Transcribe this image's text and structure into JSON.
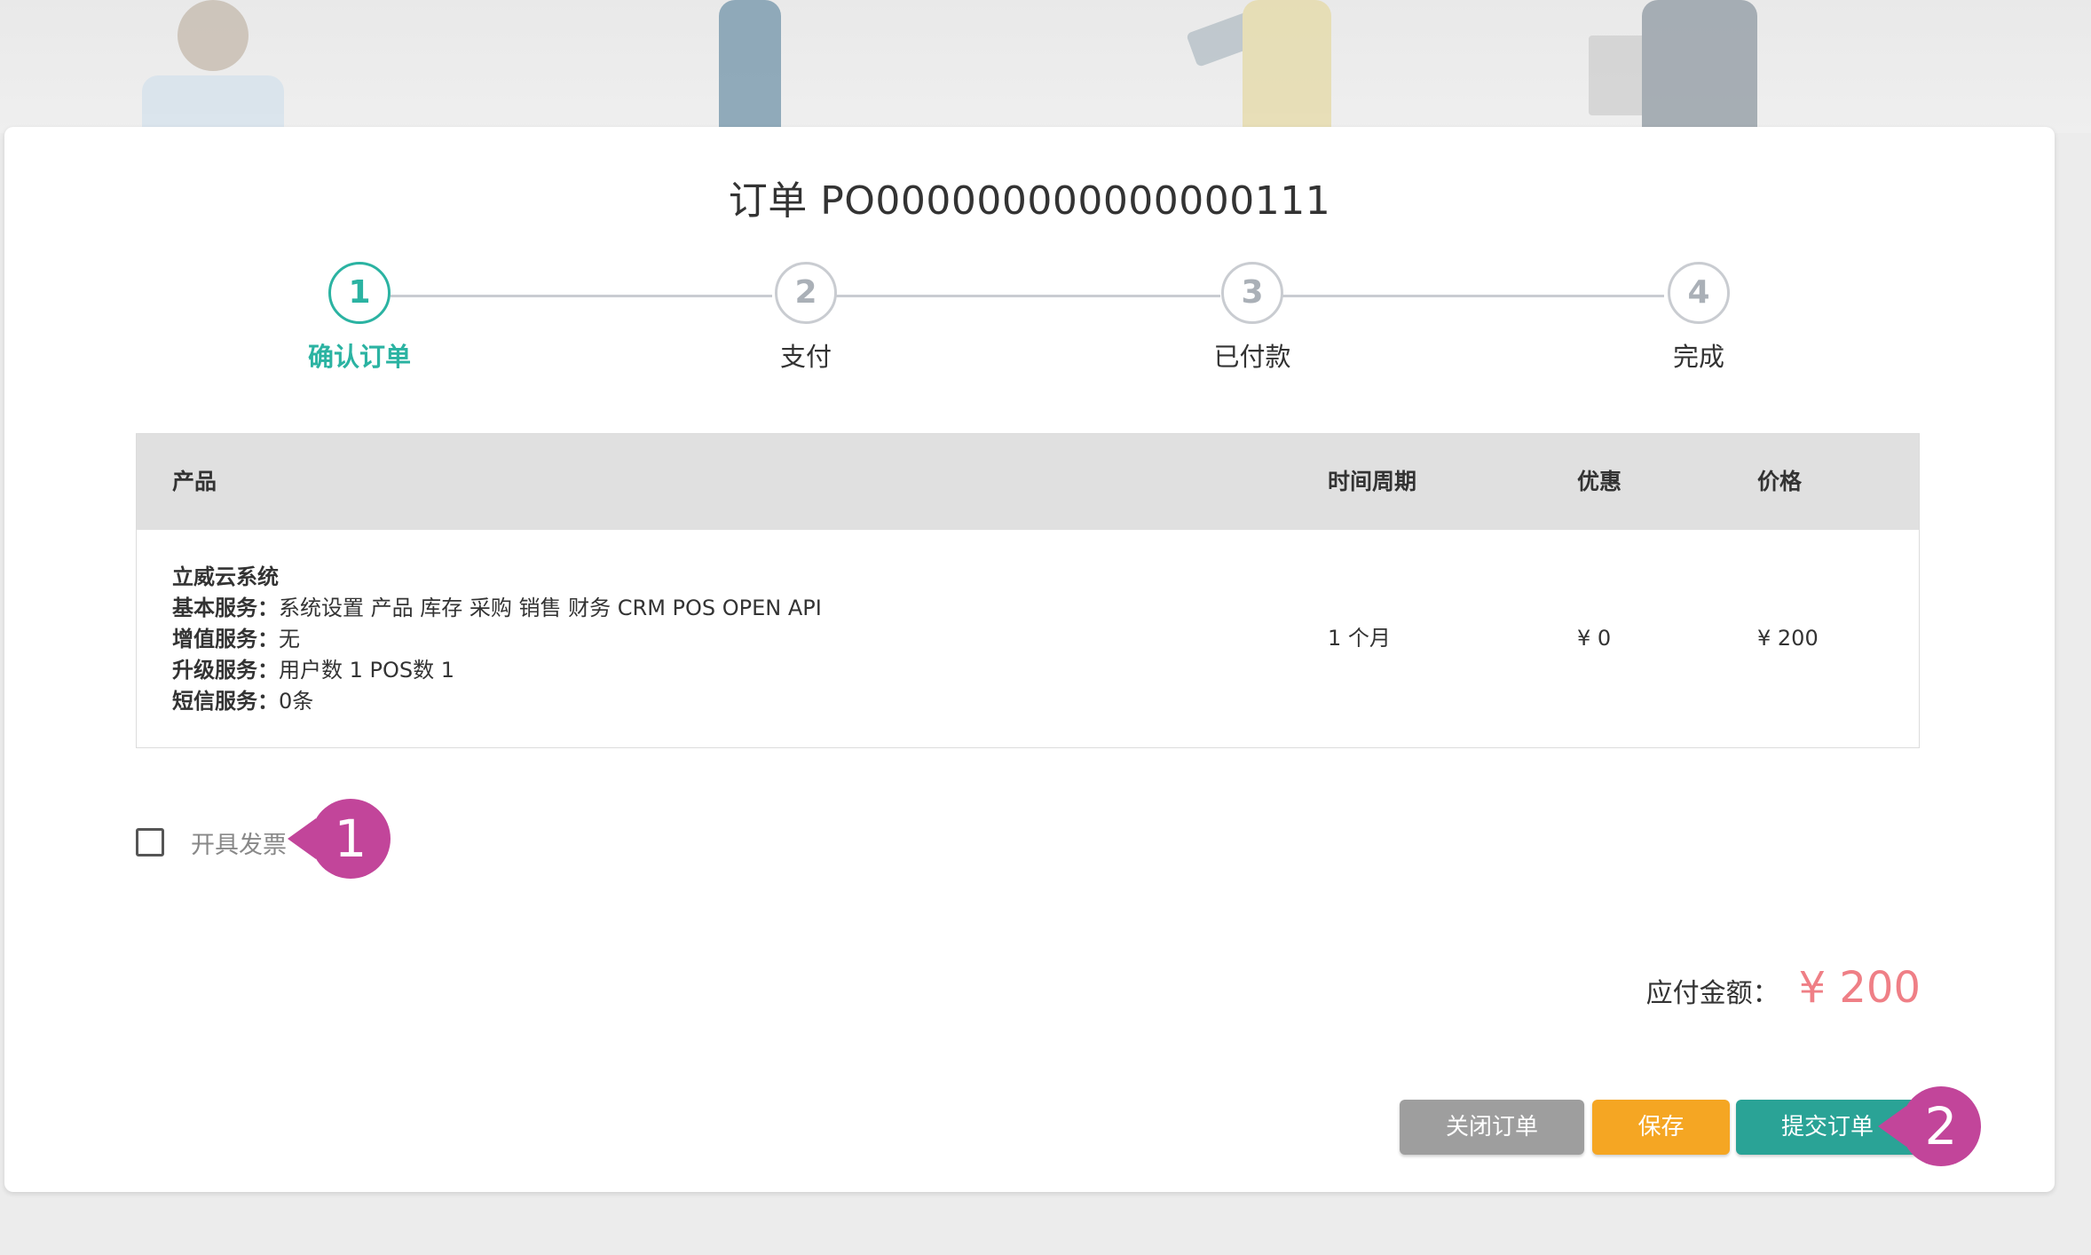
{
  "order": {
    "title": "订单 PO000000000000000111"
  },
  "steps": [
    {
      "number": "1",
      "label": "确认订单",
      "active": true
    },
    {
      "number": "2",
      "label": "支付",
      "active": false
    },
    {
      "number": "3",
      "label": "已付款",
      "active": false
    },
    {
      "number": "4",
      "label": "完成",
      "active": false
    }
  ],
  "table": {
    "headers": {
      "product": "产品",
      "period": "时间周期",
      "discount": "优惠",
      "price": "价格"
    },
    "row": {
      "product_name": "立威云系统",
      "basic_key": "基本服务：",
      "basic_value": "系统设置 产品 库存 采购 销售 财务 CRM POS OPEN API",
      "addon_key": "增值服务：",
      "addon_value": "无",
      "upgrade_key": "升级服务：",
      "upgrade_value": "用户数 1 POS数 1",
      "sms_key": "短信服务：",
      "sms_value": "0条",
      "period": "1 个月",
      "discount": "¥ 0",
      "price": "¥ 200"
    }
  },
  "invoice": {
    "label": "开具发票",
    "checked": false
  },
  "total": {
    "label": "应付金额：",
    "value": "¥ 200"
  },
  "buttons": {
    "close": "关闭订单",
    "save": "保存",
    "submit": "提交订单"
  },
  "markers": {
    "first": "1",
    "second": "2"
  },
  "colors": {
    "accent": "#2bb3a2",
    "inactive_step": "#c9ccd1",
    "close_button": "#9e9e9e",
    "save_button": "#f5a623",
    "submit_button": "#2aa396",
    "total_amount": "#ef7f86",
    "marker": "#c2459a"
  }
}
